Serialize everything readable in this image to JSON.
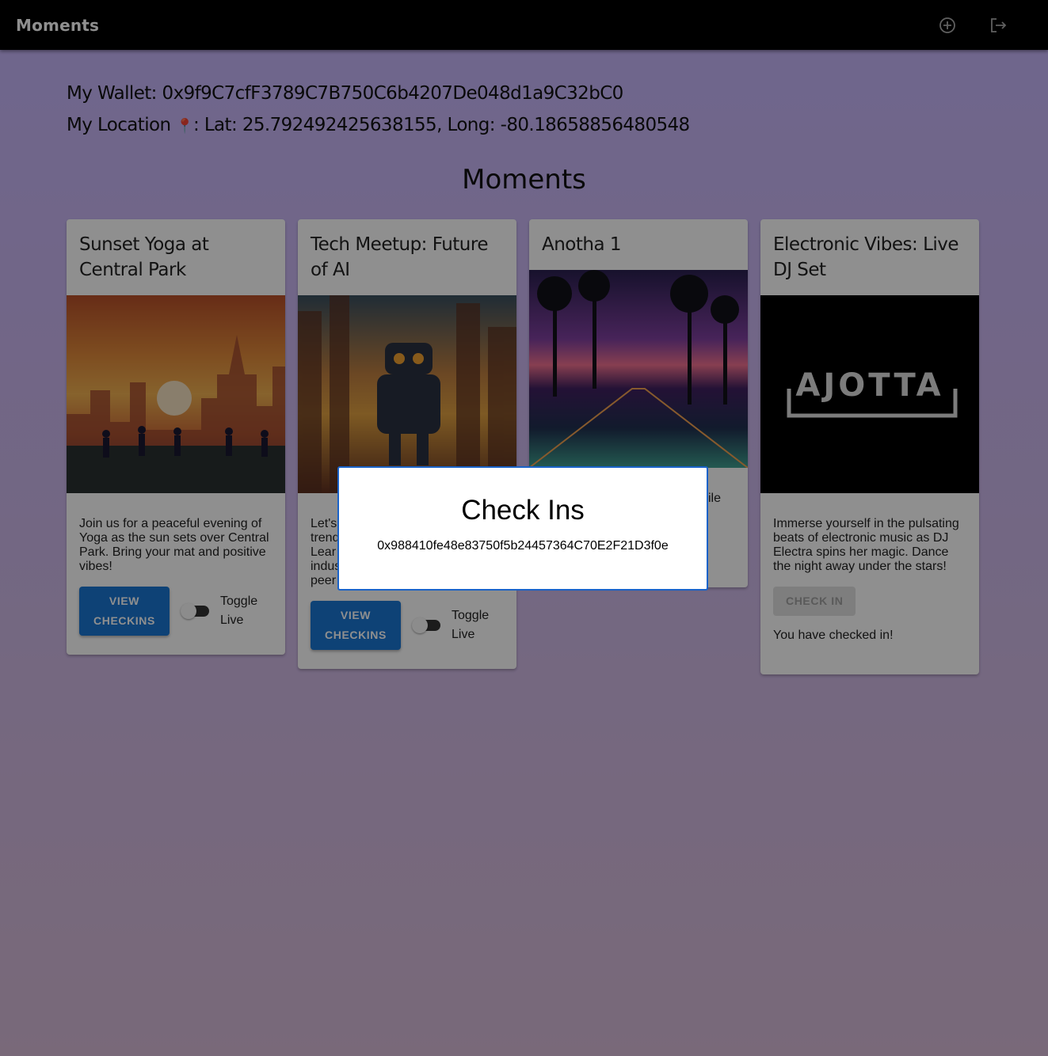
{
  "app": {
    "title": "Moments",
    "add_icon": "add-circle-icon",
    "logout_icon": "logout-icon"
  },
  "info": {
    "wallet": "My Wallet: 0x9f9C7cfF3789C7B750C6b4207De048d1a9C32bC0",
    "location_prefix": "My Location ",
    "location_pin": "📍",
    "location_suffix": ": Lat: 25.792492425638155, Long: -80.18658856480548"
  },
  "heading": "Moments",
  "cards": [
    {
      "title": "Sunset Yoga at Central Park",
      "description": "Join us for a peaceful evening of Yoga as the sun sets over Central Park. Bring your mat and positive vibes!",
      "button": "VIEW CHECKINS",
      "toggle_label": "Toggle Live",
      "toggle_on": false
    },
    {
      "title": "Tech Meetup: Future of AI",
      "description_fragments": [
        "Let's",
        "trend",
        "Lear",
        "indus",
        "peer"
      ],
      "button": "VIEW CHECKINS",
      "toggle_label": "Toggle Live",
      "toggle_on": false
    },
    {
      "title": "Anotha 1",
      "description_fragment": "ile"
    },
    {
      "title": "Electronic Vibes: Live DJ Set",
      "description": "Immerse yourself in the pulsating beats of electronic music as DJ Electra spins her magic. Dance the night away under the stars!",
      "button": "CHECK IN",
      "button_disabled": true,
      "status": "You have checked in!",
      "logo_text": "AJOTTA"
    }
  ],
  "modal": {
    "title": "Check Ins",
    "address": "0x988410fe48e83750f5b24457364C70E2F21D3f0e",
    "border_color": "#1a63c9"
  }
}
